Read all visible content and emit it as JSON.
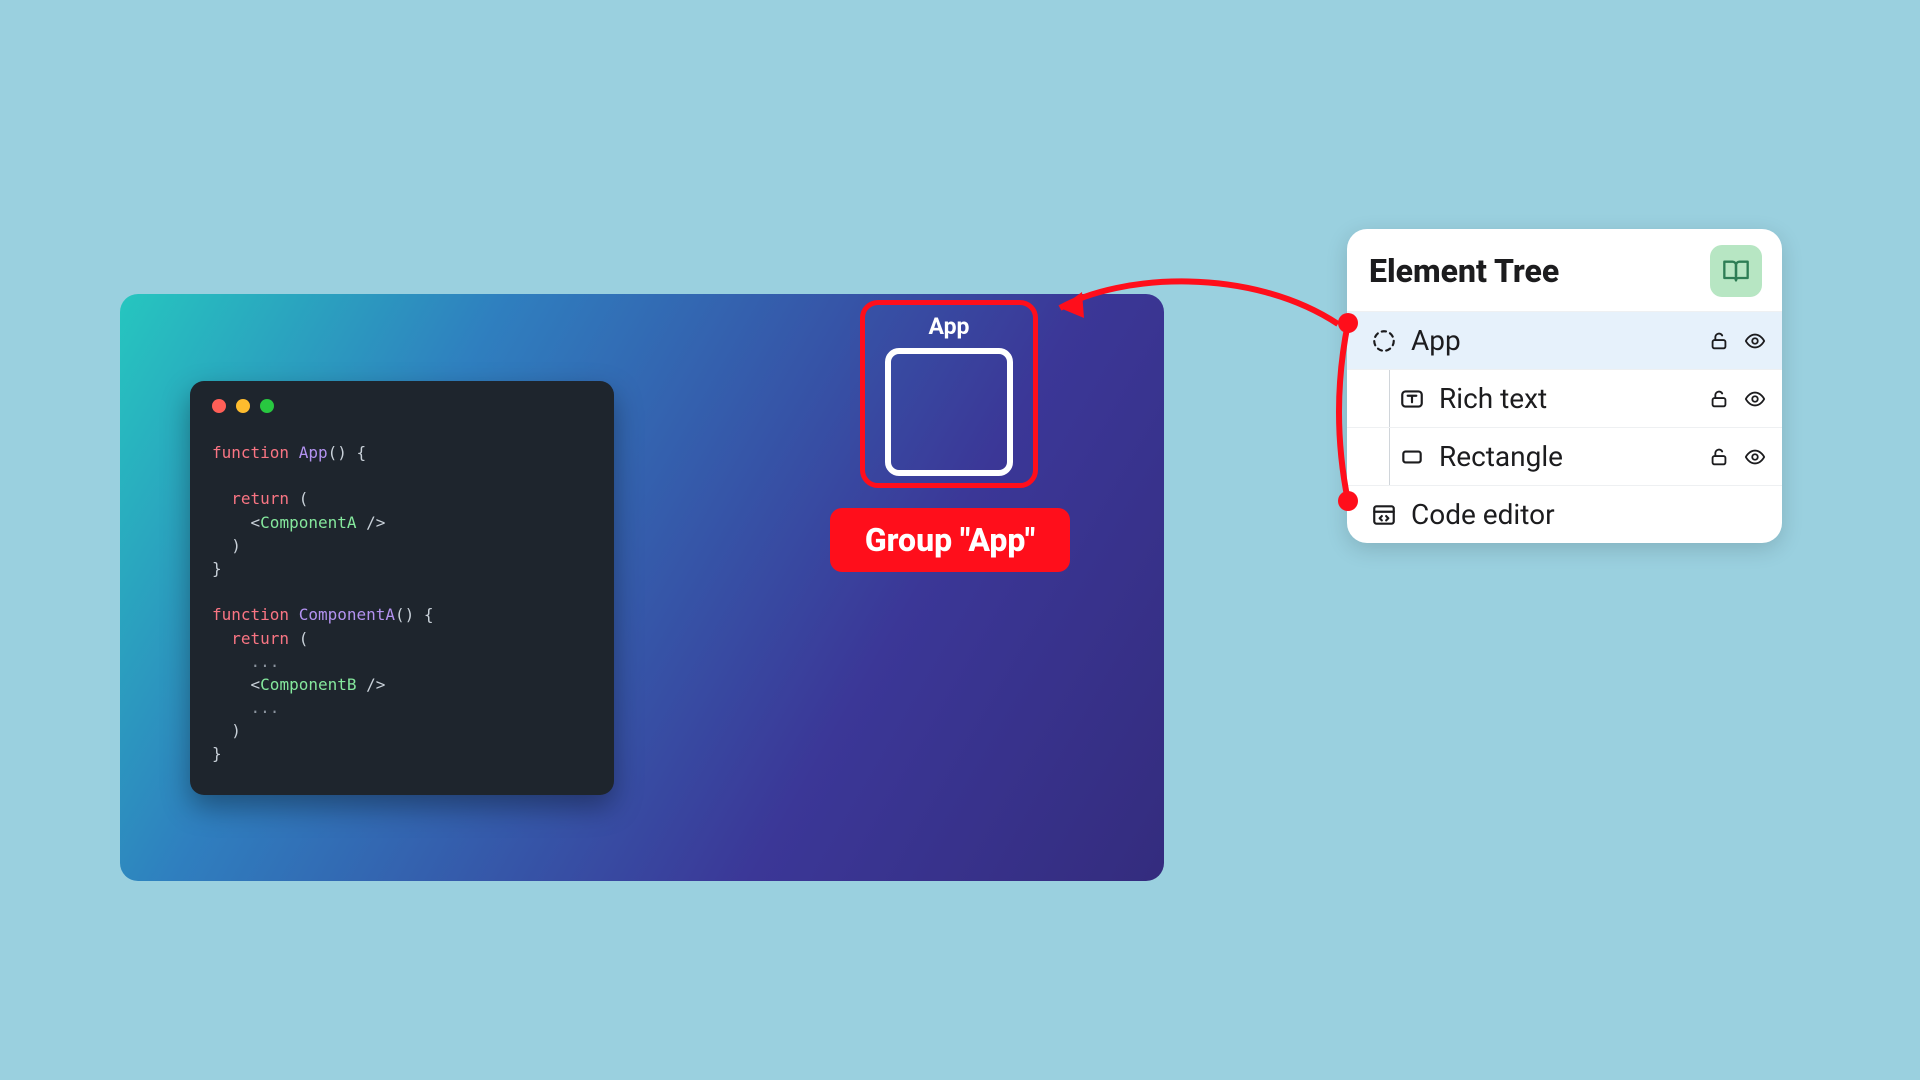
{
  "panel": {
    "title": "Element Tree",
    "items": [
      {
        "label": "App",
        "icon": "dashed-circle-icon",
        "selected": true,
        "indent": 0,
        "tools": true
      },
      {
        "label": "Rich text",
        "icon": "text-icon",
        "selected": false,
        "indent": 1,
        "tools": true
      },
      {
        "label": "Rectangle",
        "icon": "rectangle-icon",
        "selected": false,
        "indent": 1,
        "tools": true
      },
      {
        "label": "Code editor",
        "icon": "code-window-icon",
        "selected": false,
        "indent": 0,
        "tools": false
      }
    ]
  },
  "group": {
    "title": "App",
    "callout": "Group \"App\""
  },
  "code": {
    "lines": [
      [
        {
          "cls": "kw",
          "t": "function"
        },
        {
          "cls": "pun",
          "t": " "
        },
        {
          "cls": "fn",
          "t": "App"
        },
        {
          "cls": "pun",
          "t": "() {"
        }
      ],
      [
        {
          "cls": "pun",
          "t": ""
        }
      ],
      [
        {
          "cls": "pun",
          "t": "  "
        },
        {
          "cls": "kw",
          "t": "return"
        },
        {
          "cls": "pun",
          "t": " ("
        }
      ],
      [
        {
          "cls": "pun",
          "t": "    <"
        },
        {
          "cls": "tag",
          "t": "ComponentA"
        },
        {
          "cls": "pun",
          "t": " />"
        }
      ],
      [
        {
          "cls": "pun",
          "t": "  )"
        }
      ],
      [
        {
          "cls": "pun",
          "t": "}"
        }
      ],
      [
        {
          "cls": "pun",
          "t": ""
        }
      ],
      [
        {
          "cls": "kw",
          "t": "function"
        },
        {
          "cls": "pun",
          "t": " "
        },
        {
          "cls": "fn",
          "t": "ComponentA"
        },
        {
          "cls": "pun",
          "t": "() {"
        }
      ],
      [
        {
          "cls": "pun",
          "t": "  "
        },
        {
          "cls": "kw",
          "t": "return"
        },
        {
          "cls": "pun",
          "t": " ("
        }
      ],
      [
        {
          "cls": "pun",
          "t": "    "
        },
        {
          "cls": "dots",
          "t": "..."
        }
      ],
      [
        {
          "cls": "pun",
          "t": "    <"
        },
        {
          "cls": "tag",
          "t": "ComponentB"
        },
        {
          "cls": "pun",
          "t": " />"
        }
      ],
      [
        {
          "cls": "pun",
          "t": "    "
        },
        {
          "cls": "dots",
          "t": "..."
        }
      ],
      [
        {
          "cls": "pun",
          "t": "  )"
        }
      ],
      [
        {
          "cls": "pun",
          "t": "}"
        }
      ]
    ]
  },
  "colors": {
    "annotation": "#FF0E1B",
    "badge_bg": "#B7E6C3"
  }
}
